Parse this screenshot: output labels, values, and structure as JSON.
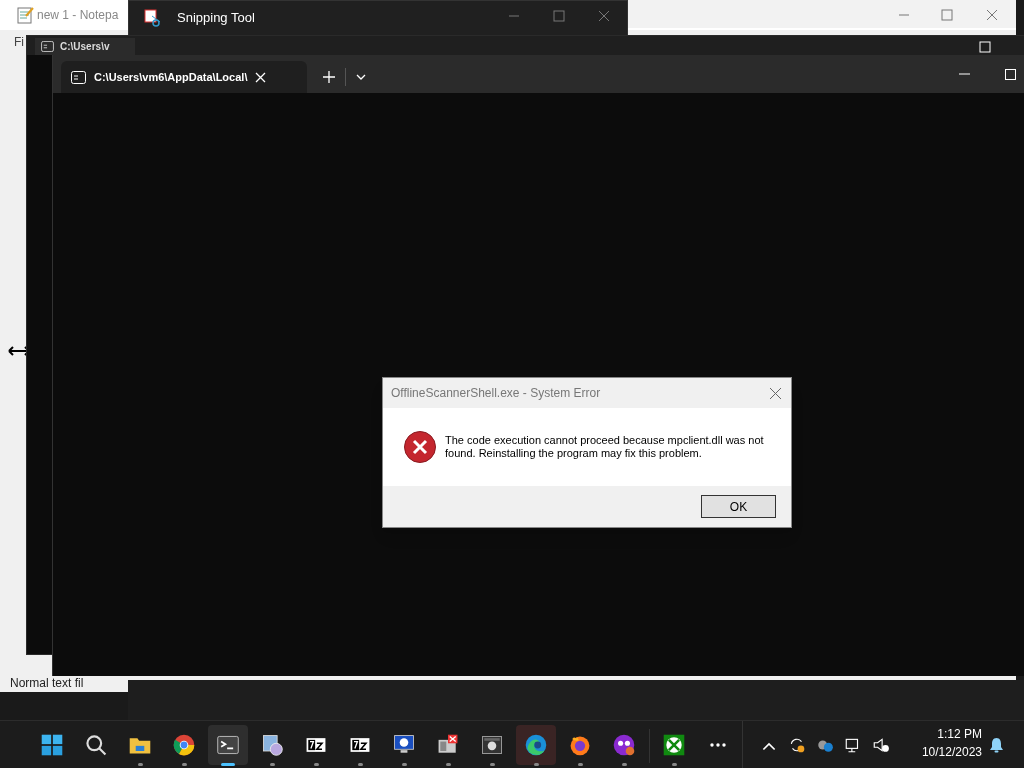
{
  "notepad": {
    "title": "new 1 - Notepa",
    "menu": "Fi",
    "status": "Normal text fil"
  },
  "snipping_tool": {
    "title": "Snipping Tool"
  },
  "back_terminal": {
    "tab": "C:\\Users\\v"
  },
  "terminal": {
    "tab": "C:\\Users\\vm6\\AppData\\Local\\"
  },
  "dialog": {
    "title": "OfflineScannerShell.exe - System Error",
    "message": "The code execution cannot proceed because mpclient.dll was not found. Reinstalling the program may fix this problem.",
    "button": "OK"
  },
  "taskbar": {
    "apps": [
      {
        "kind": "start",
        "selected": false,
        "running": false
      },
      {
        "kind": "search",
        "selected": false,
        "running": false
      },
      {
        "kind": "folder",
        "selected": false,
        "running": true
      },
      {
        "kind": "chrome",
        "selected": false,
        "running": true
      },
      {
        "kind": "terminal",
        "selected": true,
        "running": true
      },
      {
        "kind": "installer",
        "selected": false,
        "running": true
      },
      {
        "kind": "archive",
        "selected": false,
        "running": true
      },
      {
        "kind": "archive",
        "selected": false,
        "running": true
      },
      {
        "kind": "monitor",
        "selected": false,
        "running": true
      },
      {
        "kind": "archive_error",
        "selected": false,
        "running": true
      },
      {
        "kind": "darkapp",
        "selected": false,
        "running": true
      },
      {
        "kind": "edge",
        "selected": false,
        "running": true,
        "highlighted": true
      },
      {
        "kind": "firefox",
        "selected": false,
        "running": true
      },
      {
        "kind": "mask",
        "selected": false,
        "running": true
      },
      {
        "kind": "xbox",
        "selected": false,
        "running": true
      },
      {
        "kind": "more",
        "selected": false,
        "running": false
      }
    ],
    "tray": [
      {
        "kind": "chevron"
      },
      {
        "kind": "sync"
      },
      {
        "kind": "cloud"
      },
      {
        "kind": "network"
      },
      {
        "kind": "muted"
      }
    ],
    "time": "1:12 PM",
    "date": "10/12/2023"
  }
}
